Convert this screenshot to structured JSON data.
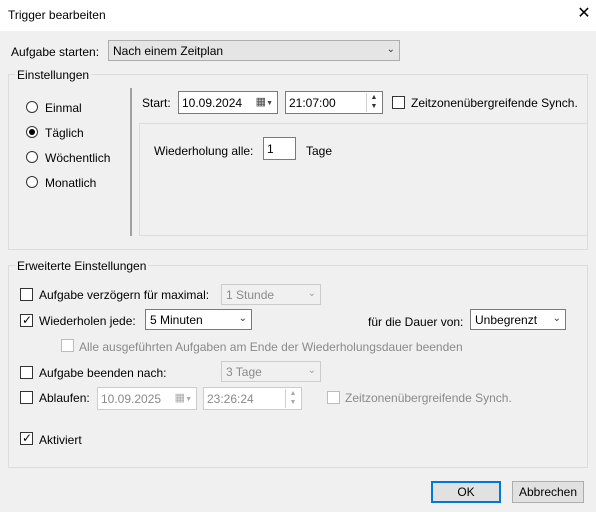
{
  "window": {
    "title": "Trigger bearbeiten",
    "close_glyph": "✕"
  },
  "start_task": {
    "label": "Aufgabe starten:",
    "value": "Nach einem Zeitplan"
  },
  "settings": {
    "title": "Einstellungen",
    "radios": [
      {
        "label": "Einmal",
        "checked": false
      },
      {
        "label": "Täglich",
        "checked": true
      },
      {
        "label": "Wöchentlich",
        "checked": false
      },
      {
        "label": "Monatlich",
        "checked": false
      }
    ],
    "start_label": "Start:",
    "start_date": "10.09.2024",
    "start_time": "21:07:00",
    "sync_label": "Zeitzonenübergreifende Synch.",
    "sync_checked": false,
    "repeat_label": "Wiederholung alle:",
    "repeat_value": "1",
    "repeat_unit": "Tage"
  },
  "advanced": {
    "title": "Erweiterte Einstellungen",
    "delay": {
      "label": "Aufgabe verzögern für maximal:",
      "checked": false,
      "value": "1 Stunde"
    },
    "repeat": {
      "label": "Wiederholen jede:",
      "checked": true,
      "value": "5 Minuten"
    },
    "duration": {
      "label": "für die Dauer von:",
      "value": "Unbegrenzt"
    },
    "stop_all": {
      "label": "Alle ausgeführten Aufgaben am Ende der Wiederholungsdauer beenden",
      "checked": false
    },
    "stop_after": {
      "label": "Aufgabe beenden nach:",
      "checked": false,
      "value": "3 Tage"
    },
    "expire": {
      "label": "Ablaufen:",
      "checked": false,
      "date": "10.09.2025",
      "time": "23:26:24"
    },
    "expire_sync": {
      "label": "Zeitzonenübergreifende Synch.",
      "checked": false
    },
    "enabled": {
      "label": "Aktiviert",
      "checked": true
    }
  },
  "buttons": {
    "ok": "OK",
    "cancel": "Abbrechen"
  },
  "icons": {
    "check": "✓",
    "dropdown": "⌄",
    "calendar": "▦",
    "spin_up": "▲",
    "spin_down": "▼"
  }
}
